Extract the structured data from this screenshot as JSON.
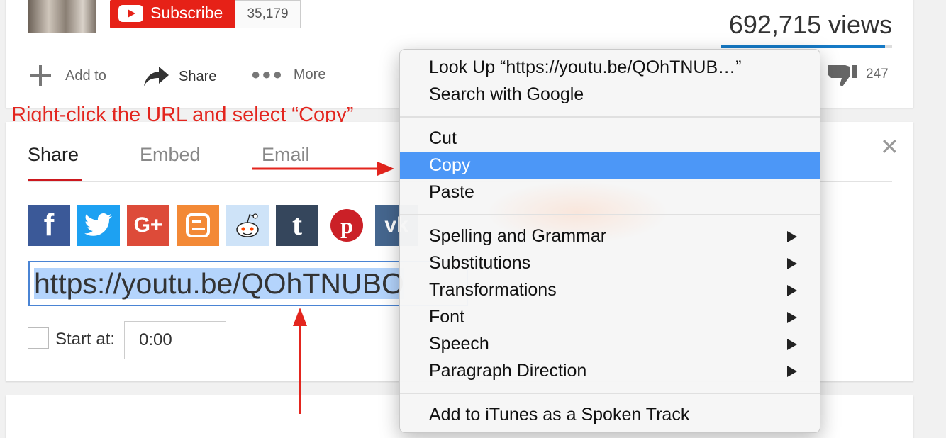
{
  "channel": {
    "subscribe_label": "Subscribe",
    "subscriber_count": "35,179"
  },
  "stats": {
    "views": "692,715 views",
    "dislike_count": "247",
    "like_ratio": 0.96
  },
  "actions": {
    "add_to": "Add to",
    "share": "Share",
    "more": "More"
  },
  "annotation": {
    "instruction": "Right-click the URL and select “Copy”"
  },
  "share_panel": {
    "tabs": [
      "Share",
      "Embed",
      "Email"
    ],
    "active_tab": "Share",
    "close_icon": "close-icon",
    "social_icons": [
      "facebook",
      "twitter",
      "google-plus",
      "blogger",
      "reddit",
      "tumblr",
      "pinterest",
      "vk"
    ],
    "social_colors": {
      "facebook": "#3b5998",
      "twitter": "#1da1f2",
      "google_plus": "#dd4b39",
      "blogger": "#f38936",
      "reddit": "#cee3f8",
      "tumblr": "#35465c",
      "pinterest": "#cb2027",
      "vk": "#45668e"
    },
    "url": "https://youtu.be/QOhTNUBO",
    "start_at_label": "Start at:",
    "start_at_value": "0:00"
  },
  "context_menu": {
    "look_up": "Look Up “https://youtu.be/QOhTNUB…”",
    "search_google": "Search with Google",
    "cut": "Cut",
    "copy": "Copy",
    "paste": "Paste",
    "spelling": "Spelling and Grammar",
    "substitutions": "Substitutions",
    "transformations": "Transformations",
    "font": "Font",
    "speech": "Speech",
    "paragraph_direction": "Paragraph Direction",
    "add_itunes": "Add to iTunes as a Spoken Track",
    "highlight_color": "#4c97f7"
  }
}
